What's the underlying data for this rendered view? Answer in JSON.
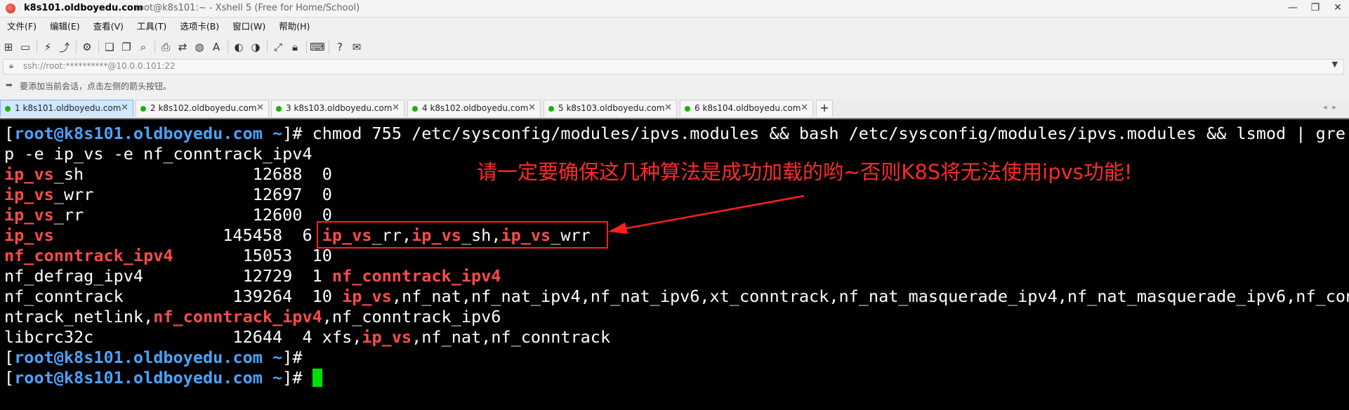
{
  "window": {
    "app_title": "k8s101.oldboyedu.com",
    "subtitle": "root@k8s101:~ - Xshell 5 (Free for Home/School)",
    "controls": [
      "—",
      "❐",
      "✕"
    ]
  },
  "menu": [
    "文件(F)",
    "编辑(E)",
    "查看(V)",
    "工具(T)",
    "选项卡(B)",
    "窗口(W)",
    "帮助(H)"
  ],
  "toolbar_icons": [
    "new-session-icon",
    "open-folder-icon",
    "disconnect-icon",
    "reconnect-icon",
    "properties-icon",
    "copy-icon",
    "paste-icon",
    "find-icon",
    "print-icon",
    "transfer-icon",
    "globe-icon",
    "font-icon",
    "xftp-icon",
    "xagent-icon",
    "fullscreen-icon",
    "lock-icon",
    "keyboard-icon",
    "help-icon",
    "chat-icon"
  ],
  "address": {
    "value": "ssh://root:**********@10.0.0.101:22"
  },
  "hint": {
    "text": "要添加当前会话，点击左侧的箭头按钮。"
  },
  "tabs": [
    {
      "label": "1 k8s101.oldboyedu.com",
      "active": true
    },
    {
      "label": "2 k8s102.oldboyedu.com",
      "active": false
    },
    {
      "label": "3 k8s103.oldboyedu.com",
      "active": false
    },
    {
      "label": "4 k8s102.oldboyedu.com",
      "active": false
    },
    {
      "label": "5 k8s103.oldboyedu.com",
      "active": false
    },
    {
      "label": "6 k8s104.oldboyedu.com",
      "active": false
    }
  ],
  "terminal": {
    "prompt_user": "root@k8s101.oldboyedu.com",
    "prompt_dir": "~",
    "command": "chmod 755 /etc/sysconfig/modules/ipvs.modules && bash /etc/sysconfig/modules/ipvs.modules && lsmod | gre",
    "command_wrap": "p -e ip_vs -e nf_conntrack_ipv4",
    "rows": [
      {
        "mod_hl": "ip_vs",
        "mod_rest": "_sh",
        "size": "12688",
        "used": "0"
      },
      {
        "mod_hl": "ip_vs",
        "mod_rest": "_wrr",
        "size": "12697",
        "used": "0"
      },
      {
        "mod_hl": "ip_vs",
        "mod_rest": "_rr",
        "size": "12600",
        "used": "0"
      },
      {
        "mod_hl": "ip_vs",
        "mod_rest": "",
        "size": "145458",
        "used": "6"
      },
      {
        "mod_hl": "nf_conntrack_ipv4",
        "mod_rest": "",
        "size": "15053",
        "used": "10"
      },
      {
        "mod_plain": "nf_defrag_ipv4",
        "size": "12729",
        "used": "1",
        "by_hl": "nf_conntrack_ipv4"
      },
      {
        "mod_plain": "nf_conntrack",
        "size": "139264",
        "used": "10",
        "by_hl": "ip_vs",
        "by_rest": ",nf_nat,nf_nat_ipv4,nf_nat_ipv6,xt_conntrack,nf_nat_masquerade_ipv4,nf_nat_masquerade_ipv6,nf_con"
      },
      {
        "wrap_a": "ntrack_netlink,",
        "wrap_hl": "nf_conntrack_ipv4",
        "wrap_b": ",nf_conntrack_ipv6"
      },
      {
        "mod_plain": "libcrc32c",
        "size": "12644",
        "used": "4",
        "by_a": "xfs,",
        "by_hl": "ip_vs",
        "by_rest": ",nf_nat,nf_conntrack"
      }
    ],
    "ipvs_by": {
      "a_hl": "ip_vs",
      "a_rest": "_rr,",
      "b_hl": "ip_vs",
      "b_rest": "_sh,",
      "c_hl": "ip_vs",
      "c_rest": "_wrr"
    }
  },
  "annotation": {
    "text": "请一定要确保这几种算法是成功加载的哟~否则K8S将无法使用ipvs功能!"
  },
  "colors": {
    "terminal_bg": "#000000",
    "prompt": "#4aa3ff",
    "highlight": "#ff4b4b",
    "cursor": "#00e000",
    "annotation": "#ff2a2a"
  }
}
